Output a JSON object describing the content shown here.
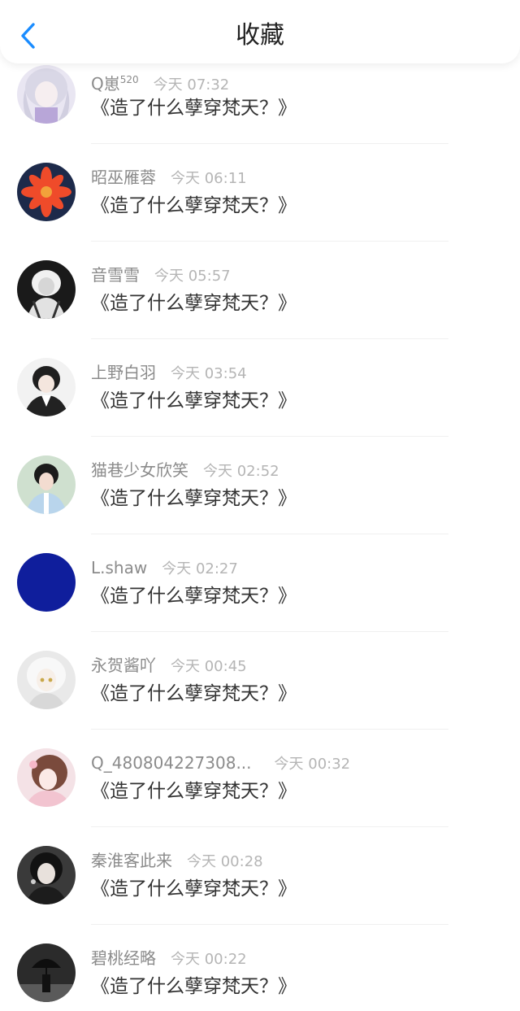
{
  "header": {
    "title": "收藏",
    "back_icon": "chevron-left-icon",
    "accent": "#1a8cff"
  },
  "items": [
    {
      "name": "Q崽",
      "badge": "520",
      "time": "今天 07:32",
      "text": "《造了什么孽穿梵天？》",
      "avatar": "avatar-silver-hair"
    },
    {
      "name": "昭巫雁蓉",
      "badge": "",
      "time": "今天 06:11",
      "text": "《造了什么孽穿梵天？》",
      "avatar": "avatar-red-flower"
    },
    {
      "name": "音雪雪",
      "badge": "",
      "time": "今天 05:57",
      "text": "《造了什么孽穿梵天？》",
      "avatar": "avatar-monochrome-sketch"
    },
    {
      "name": "上野白羽",
      "badge": "",
      "time": "今天 03:54",
      "text": "《造了什么孽穿梵天？》",
      "avatar": "avatar-dark-hair-boy"
    },
    {
      "name": "猫巷少女欣笑",
      "badge": "",
      "time": "今天 02:52",
      "text": "《造了什么孽穿梵天？》",
      "avatar": "avatar-costume-portrait"
    },
    {
      "name": "L.shaw",
      "badge": "",
      "time": "今天 02:27",
      "text": "《造了什么孽穿梵天？》",
      "avatar": "avatar-solid-blue"
    },
    {
      "name": "永贺酱吖",
      "badge": "",
      "time": "今天 00:45",
      "text": "《造了什么孽穿梵天？》",
      "avatar": "avatar-white-hair-girl"
    },
    {
      "name": "Q_480804227308...",
      "badge": "",
      "time": "今天 00:32",
      "text": "《造了什么孽穿梵天？》",
      "avatar": "avatar-pink-anime-girl"
    },
    {
      "name": "秦淮客此来",
      "badge": "",
      "time": "今天 00:28",
      "text": "《造了什么孽穿梵天？》",
      "avatar": "avatar-dark-portrait"
    },
    {
      "name": "碧桃经略",
      "badge": "",
      "time": "今天 00:22",
      "text": "《造了什么孽穿梵天？》",
      "avatar": "avatar-umbrella-silhouette"
    }
  ]
}
